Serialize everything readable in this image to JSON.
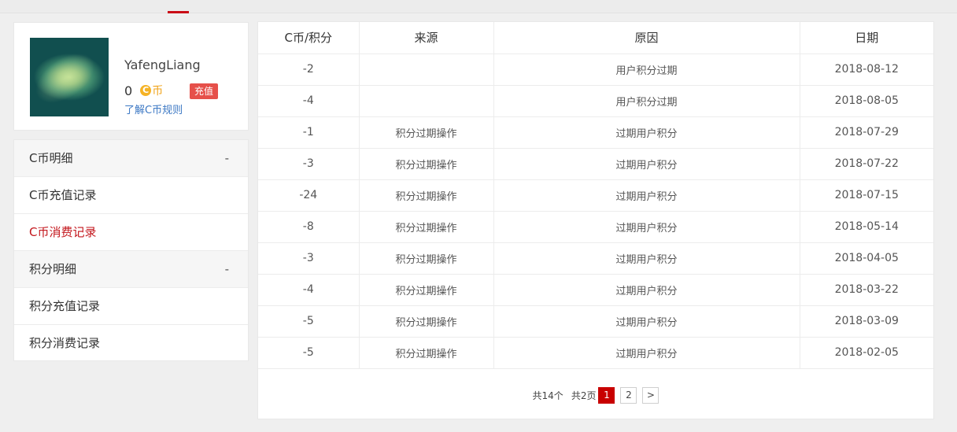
{
  "profile": {
    "username": "YafengLiang",
    "coin_count": "0",
    "coin_icon_glyph": "C",
    "coin_unit": "币",
    "recharge_label": "充值",
    "rules_link": "了解C币规则",
    "coin_color": "#f5b325",
    "recharge_color": "#e6504a"
  },
  "menu": {
    "groups": [
      {
        "label": "C币明细",
        "toggle": "-",
        "items": [
          {
            "label": "C币充值记录",
            "active": false
          },
          {
            "label": "C币消费记录",
            "active": true
          }
        ]
      },
      {
        "label": "积分明细",
        "toggle": "-",
        "items": [
          {
            "label": "积分充值记录",
            "active": false
          },
          {
            "label": "积分消费记录",
            "active": false
          }
        ]
      }
    ],
    "active_color": "#c3161c"
  },
  "table": {
    "columns": [
      "C币/积分",
      "来源",
      "原因",
      "日期"
    ],
    "rows": [
      [
        "-2",
        "",
        "用户积分过期",
        "2018-08-12"
      ],
      [
        "-4",
        "",
        "用户积分过期",
        "2018-08-05"
      ],
      [
        "-1",
        "积分过期操作",
        "过期用户积分",
        "2018-07-29"
      ],
      [
        "-3",
        "积分过期操作",
        "过期用户积分",
        "2018-07-22"
      ],
      [
        "-24",
        "积分过期操作",
        "过期用户积分",
        "2018-07-15"
      ],
      [
        "-8",
        "积分过期操作",
        "过期用户积分",
        "2018-05-14"
      ],
      [
        "-3",
        "积分过期操作",
        "过期用户积分",
        "2018-04-05"
      ],
      [
        "-4",
        "积分过期操作",
        "过期用户积分",
        "2018-03-22"
      ],
      [
        "-5",
        "积分过期操作",
        "过期用户积分",
        "2018-03-09"
      ],
      [
        "-5",
        "积分过期操作",
        "过期用户积分",
        "2018-02-05"
      ]
    ]
  },
  "pager": {
    "total_items": "共14个",
    "total_pages": "共2页",
    "pages": [
      "1",
      "2"
    ],
    "current": "1",
    "next_label": ">",
    "current_color": "#c80000"
  }
}
